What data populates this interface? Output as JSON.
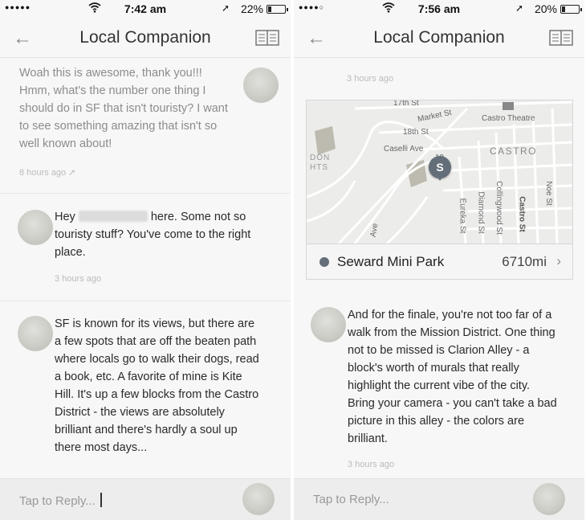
{
  "left": {
    "status": {
      "signal": "●●●●●",
      "wifi": "wifi",
      "time": "7:42 am",
      "battery_pct": "22%",
      "battery_level": 0.22
    },
    "nav": {
      "title": "Local Companion",
      "back_icon": "back-arrow-icon",
      "book_icon": "book-icon"
    },
    "messages": [
      {
        "text": "Woah this is awesome, thank you!!! Hmm, what's the number one thing I should do in SF that isn't touristy? I want to see something amazing that isn't so well known about!",
        "time": "8 hours ago"
      },
      {
        "text_before": "Hey",
        "text_after": "here. Some not so touristy stuff? You've come to the right place.",
        "time": "3 hours ago"
      },
      {
        "text": "SF is known for its views, but there are a few spots that are off the beaten path where locals go to walk their dogs, read a book, etc. A favorite of mine is Kite Hill. It's up a few blocks from the Castro District - the views are absolutely brilliant and there's hardly a soul up there most days..."
      }
    ],
    "reply": {
      "placeholder": "Tap to Reply..."
    }
  },
  "right": {
    "status": {
      "signal": "●●●●○",
      "wifi": "wifi",
      "time": "7:56 am",
      "battery_pct": "20%",
      "battery_level": 0.2
    },
    "nav": {
      "title": "Local Companion",
      "back_icon": "back-arrow-icon",
      "book_icon": "book-icon"
    },
    "top_time": "3 hours ago",
    "map": {
      "labels": {
        "s17": "17th St",
        "market": "Market St",
        "castro_theatre": "Castro Theatre",
        "s18": "18th St",
        "caselli": "Caselli Ave",
        "castro": "CASTRO",
        "don": "DON",
        "hts": "HTS",
        "s19": "19",
        "eureka": "Eureka St",
        "diamond": "Diamond St",
        "collingwood": "Collingwood St",
        "castro_st": "Castro St",
        "noe": "Noe St",
        "ave": "Ave"
      },
      "pin_letter": "S",
      "place_name": "Seward Mini Park",
      "distance": "6710mi",
      "chevron": "›"
    },
    "message": {
      "text": "And for the finale, you're not too far of a walk from the Mission District. One thing not to be missed is Clarion Alley - a block's worth of murals that really highlight the current vibe of the city. Bring your camera - you can't take a bad picture in this alley - the colors are brilliant.",
      "time": "3 hours ago"
    },
    "reply": {
      "placeholder": "Tap to Reply..."
    }
  }
}
